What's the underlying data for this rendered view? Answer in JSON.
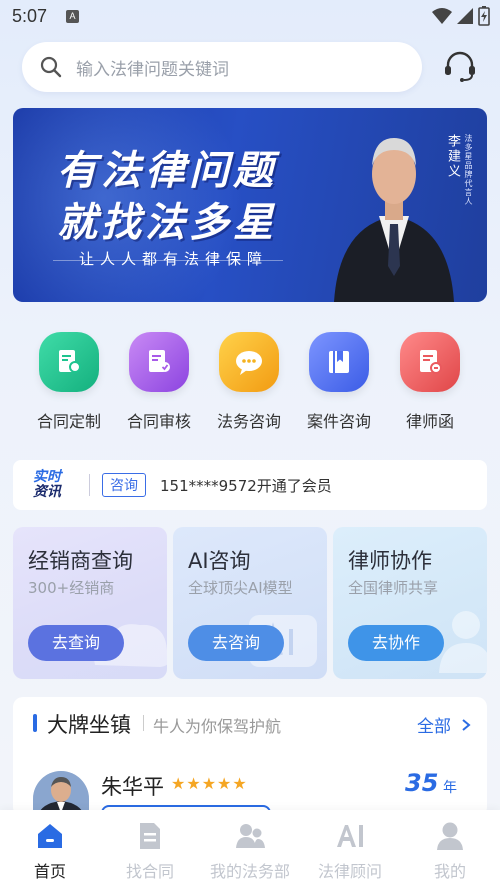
{
  "status": {
    "time": "5:07"
  },
  "search": {
    "placeholder": "输入法律问题关键词"
  },
  "banner": {
    "title_line1": "有法律问题",
    "title_line2": "就找法多星",
    "slogan": "让人人都有法律保障",
    "spokesperson_name": "李建义",
    "spokesperson_title": "法多星品牌代言人"
  },
  "services": [
    {
      "label": "合同定制",
      "icon": "contract-custom-icon",
      "color": "#1fc48f"
    },
    {
      "label": "合同审核",
      "icon": "contract-review-icon",
      "color": "#a85ae8"
    },
    {
      "label": "法务咨询",
      "icon": "chat-bubbles-icon",
      "color": "#f5b21e"
    },
    {
      "label": "案件咨询",
      "icon": "book-icon",
      "color": "#4d6ff0"
    },
    {
      "label": "律师函",
      "icon": "lawyer-letter-icon",
      "color": "#ea5a5e"
    }
  ],
  "ticker": {
    "logo_line1": "实时",
    "logo_line2": "资讯",
    "tag": "咨询",
    "message": "151****9572开通了会员"
  },
  "cards": [
    {
      "title": "经销商查询",
      "subtitle": "300+经销商",
      "button": "去查询",
      "color": "#5b72e0"
    },
    {
      "title": "AI咨询",
      "subtitle": "全球顶尖AI模型",
      "button": "去咨询",
      "color": "#4e8ee6"
    },
    {
      "title": "律师协作",
      "subtitle": "全国律师共享",
      "button": "去协作",
      "color": "#3f94e8"
    }
  ],
  "lawyers": {
    "title": "大牌坐镇",
    "subtitle": "牛人为你保驾护航",
    "more": "全部",
    "first": {
      "name": "朱华平",
      "rating": 5,
      "stars": "★★★★★",
      "years": "35",
      "years_unit": "年"
    }
  },
  "tabs": [
    {
      "label": "首页",
      "icon": "home-icon",
      "active": true
    },
    {
      "label": "找合同",
      "icon": "document-icon",
      "active": false
    },
    {
      "label": "我的法务部",
      "icon": "team-icon",
      "active": false
    },
    {
      "label": "法律顾问",
      "icon": "ai-icon",
      "active": false
    },
    {
      "label": "我的",
      "icon": "profile-icon",
      "active": false
    }
  ],
  "colors": {
    "accent": "#2a6be3",
    "banner": "#2249b8"
  }
}
